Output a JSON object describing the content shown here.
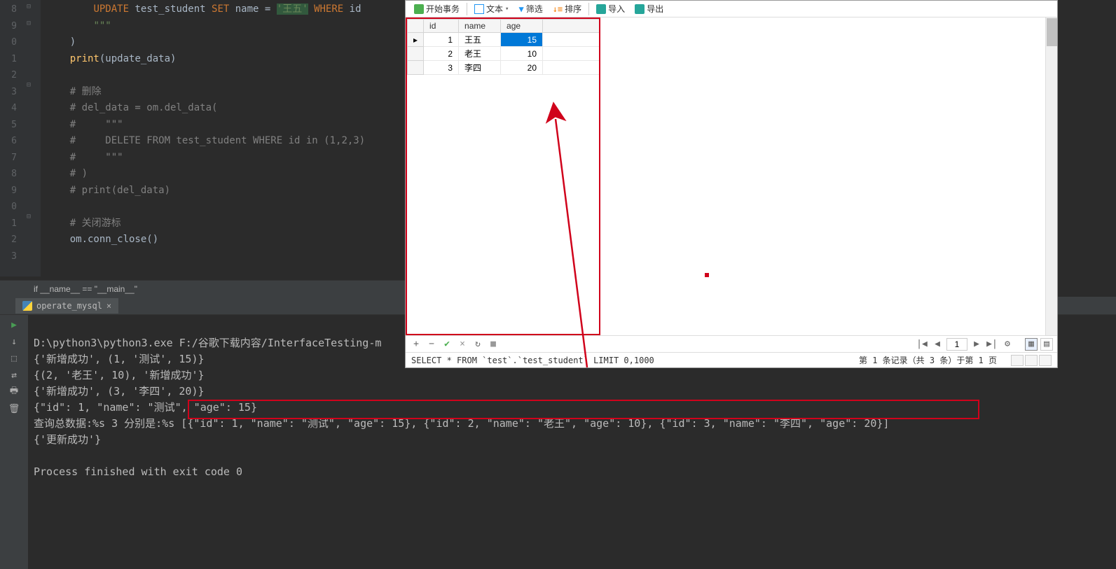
{
  "editor": {
    "line_numbers": [
      "8",
      "9",
      "0",
      "1",
      "2",
      "3",
      "4",
      "5",
      "6",
      "7",
      "8",
      "9",
      "0",
      "1",
      "2",
      "3"
    ],
    "code_html": "        <span class='c-kw'>UPDATE</span> test_student <span class='c-kw'>SET</span> name = <span class='c-hl'>'王五'</span> <span class='c-kw'>WHERE</span> id\n        <span class='c-str'>\"\"\"</span>\n    )\n    <span class='c-fn'>print</span>(update_data)\n\n    <span class='c-cmt'># 删除</span>\n    <span class='c-cmt'># del_data = om.del_data(</span>\n    <span class='c-cmt'>#     \"\"\"</span>\n    <span class='c-cmt'>#     DELETE FROM test_student WHERE id in (1,2,3)</span>\n    <span class='c-cmt'>#     \"\"\"</span>\n    <span class='c-cmt'># )</span>\n    <span class='c-cmt'># print(del_data)</span>\n\n    <span class='c-cmt'># 关闭游标</span>\n    om.conn_close()\n"
  },
  "breadcrumb": "if __name__ == \"__main__\"",
  "console": {
    "tab_label": "operate_mysql",
    "lines": {
      "l1": "D:\\python3\\python3.exe F:/谷歌下载内容/InterfaceTesting-m",
      "l2": "{'新增成功', (1, '测试', 15)}",
      "l3": "{(2, '老王', 10), '新增成功'}",
      "l4": "{'新增成功', (3, '李四', 20)}",
      "l5": "{\"id\": 1, \"name\": \"测试\", \"age\": 15}",
      "l6a": "查询总数据:%s 3 分别是:%s",
      "l6b": " [{\"id\": 1, \"name\": \"测试\", \"age\": 15}, {\"id\": 2, \"name\": \"老王\", \"age\": 10}, {\"id\": 3, \"name\": \"李四\", \"age\": 20}]",
      "l7": "{'更新成功'}",
      "l8": "",
      "l9": "Process finished with exit code 0"
    }
  },
  "db": {
    "toolbar": {
      "begin_tx": "开始事务",
      "text": "文本",
      "filter": "筛选",
      "sort": "排序",
      "import": "导入",
      "export": "导出"
    },
    "headers": {
      "id": "id",
      "name": "name",
      "age": "age"
    },
    "rows": [
      {
        "id": "1",
        "name": "王五",
        "age": "15",
        "selected": true
      },
      {
        "id": "2",
        "name": "老王",
        "age": "10",
        "selected": false
      },
      {
        "id": "3",
        "name": "李四",
        "age": "20",
        "selected": false
      }
    ],
    "page_input": "1",
    "status_sql": "SELECT * FROM `test`.`test_student` LIMIT 0,1000",
    "status_page": "第 1 条记录（共 3 条）于第 1 页"
  }
}
